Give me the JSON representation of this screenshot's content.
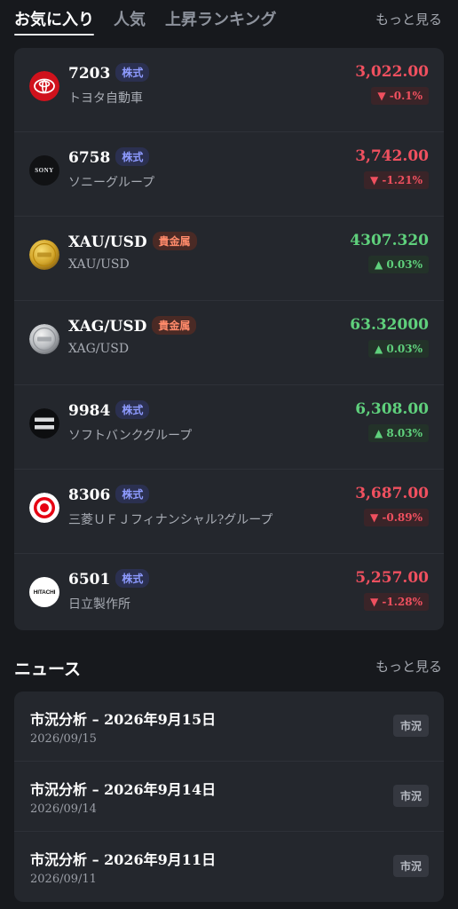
{
  "tabs": [
    {
      "label": "お気に入り",
      "active": true
    },
    {
      "label": "人気",
      "active": false
    },
    {
      "label": "上昇ランキング",
      "active": false
    }
  ],
  "tabs_more": "もっと見る",
  "watchlist": [
    {
      "code": "7203",
      "badge": "株式",
      "badge_type": "stock",
      "name": "トヨタ自動車",
      "price": "3,022.00",
      "change": "▼ -0.1%",
      "direction": "down",
      "logo": "toyota-logo-icon"
    },
    {
      "code": "6758",
      "badge": "株式",
      "badge_type": "stock",
      "name": "ソニーグループ",
      "price": "3,742.00",
      "change": "▼ -1.21%",
      "direction": "down",
      "logo": "sony-logo-icon",
      "logo_text": "SONY"
    },
    {
      "code": "XAU/USD",
      "badge": "貴金属",
      "badge_type": "metal",
      "name": "XAU/USD",
      "price": "4307.320",
      "change": "▲ 0.03%",
      "direction": "up",
      "logo": "gold-coin-icon"
    },
    {
      "code": "XAG/USD",
      "badge": "貴金属",
      "badge_type": "metal",
      "name": "XAG/USD",
      "price": "63.32000",
      "change": "▲ 0.03%",
      "direction": "up",
      "logo": "silver-coin-icon"
    },
    {
      "code": "9984",
      "badge": "株式",
      "badge_type": "stock",
      "name": "ソフトバンクグループ",
      "price": "6,308.00",
      "change": "▲ 8.03%",
      "direction": "up",
      "logo": "softbank-logo-icon"
    },
    {
      "code": "8306",
      "badge": "株式",
      "badge_type": "stock",
      "name": "三菱ＵＦＪフィナンシャル?グループ",
      "price": "3,687.00",
      "change": "▼ -0.89%",
      "direction": "down",
      "logo": "mufg-logo-icon"
    },
    {
      "code": "6501",
      "badge": "株式",
      "badge_type": "stock",
      "name": "日立製作所",
      "price": "5,257.00",
      "change": "▼ -1.28%",
      "direction": "down",
      "logo": "hitachi-logo-icon",
      "logo_text": "HITACHI"
    }
  ],
  "news_section": {
    "title": "ニュース",
    "more": "もっと見る",
    "items": [
      {
        "title": "市況分析 – 2026年9月15日",
        "date": "2026/09/15",
        "tag": "市況"
      },
      {
        "title": "市況分析 – 2026年9月14日",
        "date": "2026/09/14",
        "tag": "市況"
      },
      {
        "title": "市況分析 – 2026年9月11日",
        "date": "2026/09/11",
        "tag": "市況"
      }
    ]
  },
  "colors": {
    "up": "#5fd07c",
    "down": "#f0505f",
    "background": "#17191d",
    "card": "#24272d"
  }
}
